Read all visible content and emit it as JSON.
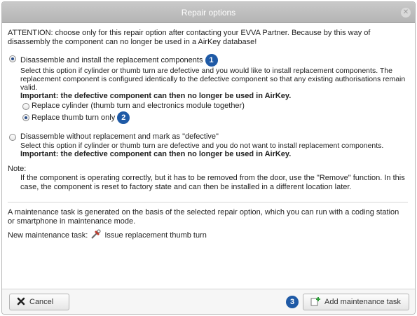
{
  "dialog": {
    "title": "Repair options"
  },
  "attention": "ATTENTION: choose only for this repair option after contacting your EVVA Partner. Because by this way of disassembly the component can no longer be used in a AirKey database!",
  "option1": {
    "label": "Disassemble and install the replacement components",
    "desc": "Select this option if cylinder or thumb turn are defective and you would like to install replacement components. The replacement component is configured identically to the defective component so that any existing authorisations remain valid.",
    "important": "Important: the defective component can then no longer be used in AirKey.",
    "sub1": "Replace cylinder (thumb turn and electronics module together)",
    "sub2": "Replace thumb turn only"
  },
  "option2": {
    "label": "Disassemble without replacement and mark as \"defective\"",
    "desc": "Select this option if cylinder or thumb turn are defective and you do not want to install replacement components.",
    "important": "Important: the defective component can then no longer be used in AirKey."
  },
  "note": {
    "heading": "Note:",
    "text": "If the component is operating correctly, but it has to be removed from the door, use the \"Remove\" function. In this case, the component is reset to factory state and can then be installed in a different location later."
  },
  "maintenance": {
    "info": "A maintenance task is generated on the basis of the selected repair option, which you can run with a coding station or smartphone in maintenance mode.",
    "label": "New maintenance task:",
    "task": "Issue replacement thumb turn"
  },
  "badges": {
    "b1": "1",
    "b2": "2",
    "b3": "3"
  },
  "buttons": {
    "cancel": "Cancel",
    "add": "Add maintenance task"
  }
}
